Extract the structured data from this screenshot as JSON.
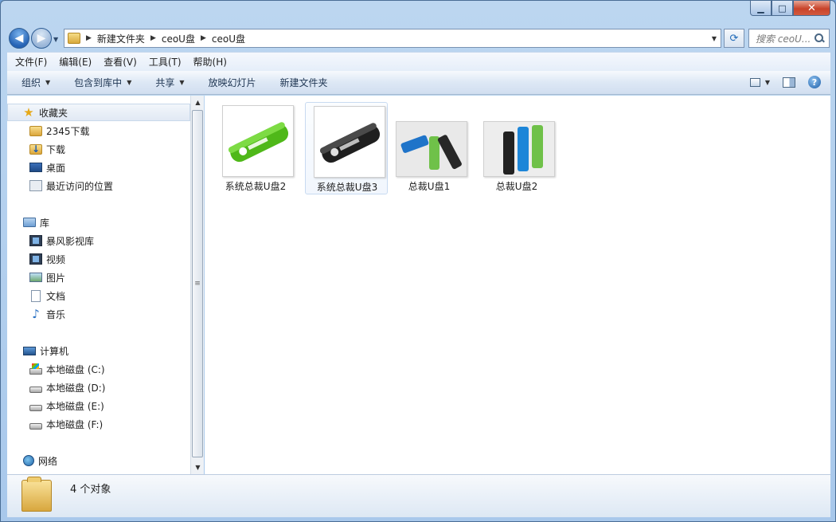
{
  "window": {
    "caption": {
      "minimize": "▁",
      "maximize": "□",
      "close": "✕"
    }
  },
  "address": {
    "crumbs": [
      "新建文件夹",
      "ceoU盘",
      "ceoU盘"
    ],
    "search_placeholder": "搜索 ceoU..."
  },
  "menu": [
    "文件(F)",
    "编辑(E)",
    "查看(V)",
    "工具(T)",
    "帮助(H)"
  ],
  "toolbar": {
    "organize": "组织",
    "include_in_library": "包含到库中",
    "share": "共享",
    "slideshow": "放映幻灯片",
    "new_folder": "新建文件夹"
  },
  "nav": {
    "favorites": {
      "label": "收藏夹",
      "items": [
        "2345下载",
        "下载",
        "桌面",
        "最近访问的位置"
      ]
    },
    "libraries": {
      "label": "库",
      "items": [
        "暴风影视库",
        "视频",
        "图片",
        "文档",
        "音乐"
      ]
    },
    "computer": {
      "label": "计算机",
      "items": [
        "本地磁盘 (C:)",
        "本地磁盘 (D:)",
        "本地磁盘 (E:)",
        "本地磁盘 (F:)"
      ]
    },
    "network": {
      "label": "网络"
    }
  },
  "files": [
    {
      "name": "系统总裁U盘2",
      "thumb_color": "#5cc11e"
    },
    {
      "name": "系统总裁U盘3",
      "thumb_color": "#222222"
    },
    {
      "name": "总裁U盘1",
      "thumb_color": "#1f74c9"
    },
    {
      "name": "总裁U盘2",
      "thumb_color": "#1d86d8"
    }
  ],
  "status": {
    "count": "4 个对象"
  }
}
